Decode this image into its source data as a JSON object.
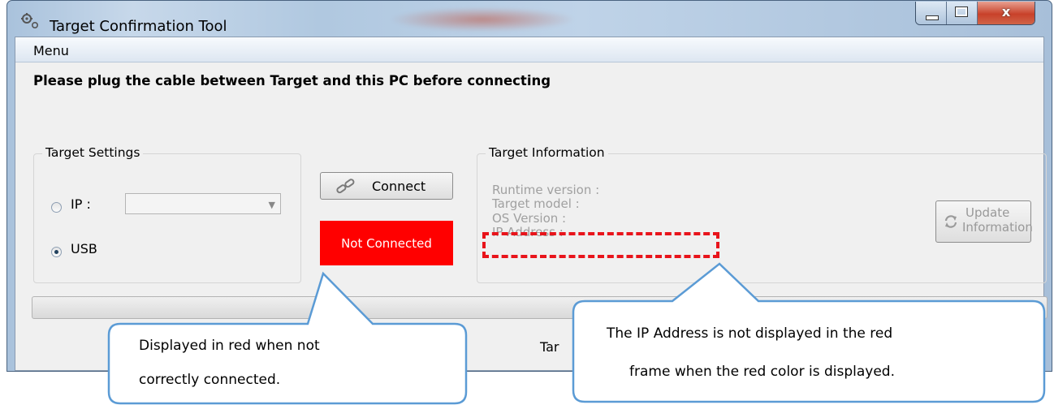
{
  "window": {
    "title": "Target Confirmation Tool"
  },
  "menu": {
    "items": [
      "Menu"
    ]
  },
  "instruction": "Please plug the cable between Target and this PC before connecting",
  "target_settings": {
    "title": "Target Settings",
    "ip_label": "IP :",
    "ip_value": "",
    "usb_label": "USB",
    "selected": "USB"
  },
  "connect": {
    "label": "Connect"
  },
  "status": {
    "text": "Not Connected",
    "color": "#ff0000"
  },
  "target_info": {
    "title": "Target Information",
    "runtime": "Runtime version :",
    "model": "Target model :",
    "os": "OS Version :",
    "ip": "IP Address :",
    "update_line1": "Update",
    "update_line2": "Information"
  },
  "bottom": {
    "partial_text": "Tar"
  },
  "callouts": {
    "left_line1": "Displayed in red when not",
    "left_line2": "correctly connected.",
    "right_line1": "The IP Address is not displayed in the red",
    "right_line2": "frame when the red color is displayed."
  },
  "colors": {
    "callout_border": "#5b9bd5",
    "frame": "#e8141b"
  }
}
